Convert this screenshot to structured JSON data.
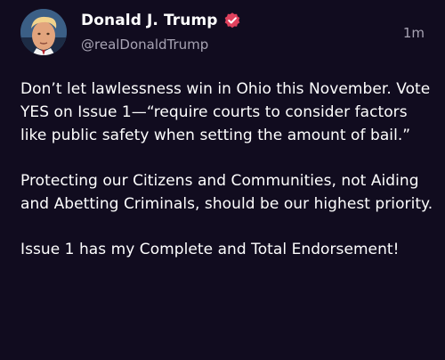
{
  "post": {
    "author": {
      "display_name": "Donald J. Trump",
      "handle": "@realDonaldTrump",
      "verified_icon": "verified-badge-icon"
    },
    "timestamp": "1m",
    "paragraphs": [
      "Don’t let lawlessness win in Ohio this November. Vote YES on Issue 1—“require courts to consider factors like public safety when setting the amount of bail.”",
      "Protecting our Citizens and Communities, not Aiding and Abetting Criminals, should be our highest priority.",
      "Issue 1 has my Complete and Total Endorsement!"
    ]
  },
  "colors": {
    "background": "#110c1f",
    "text": "#ffffff",
    "secondary_text": "#a7a3b3",
    "verified_badge": "#e0415d"
  }
}
